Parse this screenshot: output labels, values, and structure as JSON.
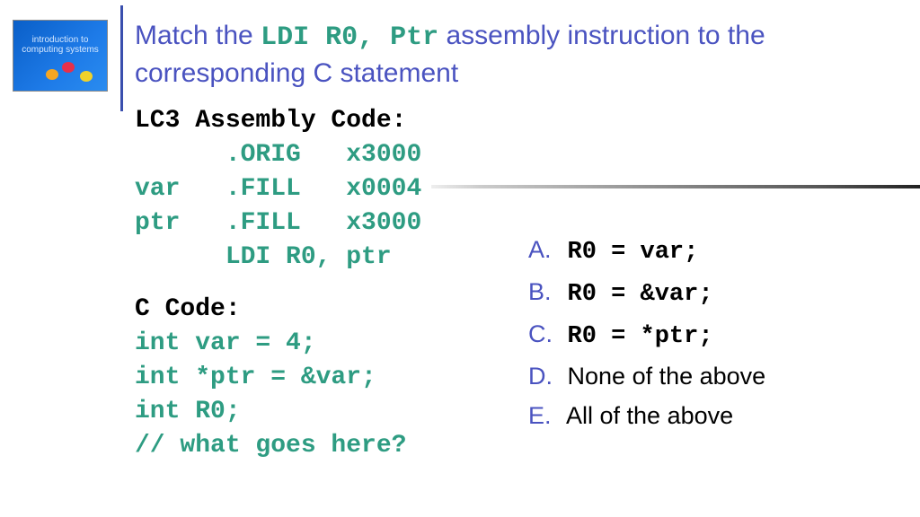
{
  "thumb": {
    "line1": "introduction to",
    "line2": "computing systems"
  },
  "title": {
    "pre": "Match the ",
    "code": "LDI R0, Ptr",
    "post": "  assembly instruction to the corresponding C statement"
  },
  "asm": {
    "header": "LC3 Assembly Code:",
    "lines": [
      "      .ORIG   x3000",
      "var   .FILL   x0004",
      "ptr   .FILL   x3000",
      "      LDI R0, ptr"
    ]
  },
  "ccode": {
    "header": "C Code:",
    "lines": [
      "int var = 4;",
      "int *ptr = &var;",
      "int R0;",
      "// what goes here?"
    ]
  },
  "answers": [
    {
      "label": "A.",
      "text": "R0 = var;",
      "mono": true
    },
    {
      "label": "B.",
      "text": "R0 = &var;",
      "mono": true
    },
    {
      "label": "C.",
      "text": "R0 = *ptr;",
      "mono": true
    },
    {
      "label": "D.",
      "text": "None of the above",
      "mono": false
    },
    {
      "label": "E.",
      "text": "All of the above",
      "mono": false
    }
  ]
}
